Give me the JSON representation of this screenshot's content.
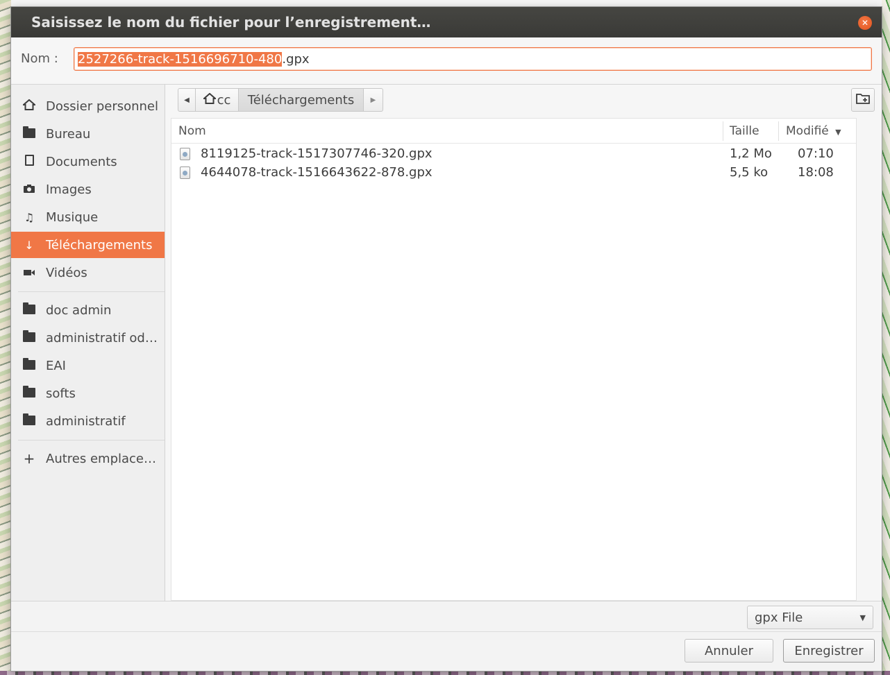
{
  "dialog": {
    "title": "Saisissez le nom du fichier pour l’enregistrement…",
    "close_icon": "close-icon"
  },
  "name_field": {
    "label": "Nom :",
    "selected_text": "2527266-track-1516696710-480",
    "unselected_text": ".gpx"
  },
  "sidebar": {
    "items": [
      {
        "label": "Dossier personnel",
        "icon": "home-icon"
      },
      {
        "label": "Bureau",
        "icon": "folder-icon"
      },
      {
        "label": "Documents",
        "icon": "document-icon"
      },
      {
        "label": "Images",
        "icon": "camera-icon"
      },
      {
        "label": "Musique",
        "icon": "music-icon"
      },
      {
        "label": "Téléchargements",
        "icon": "download-icon",
        "active": true
      },
      {
        "label": "Vidéos",
        "icon": "video-icon"
      },
      {
        "label": "doc admin",
        "icon": "folder-icon"
      },
      {
        "label": "administratif od…",
        "icon": "folder-icon"
      },
      {
        "label": "EAI",
        "icon": "folder-icon"
      },
      {
        "label": "softs",
        "icon": "folder-icon"
      },
      {
        "label": "administratif",
        "icon": "folder-icon"
      },
      {
        "label": "Autres emplace…",
        "icon": "plus-icon"
      }
    ]
  },
  "pathbar": {
    "home_label": "cc",
    "current_label": "Téléchargements"
  },
  "filelist": {
    "columns": {
      "name": "Nom",
      "size": "Taille",
      "modified": "Modifié"
    },
    "rows": [
      {
        "name": "8119125-track-1517307746-320.gpx",
        "size": "1,2 Mo",
        "modified": "07:10"
      },
      {
        "name": "4644078-track-1516643622-878.gpx",
        "size": "5,5 ko",
        "modified": "18:08"
      }
    ]
  },
  "filter": {
    "selected": "gpx File"
  },
  "buttons": {
    "cancel": "Annuler",
    "save": "Enregistrer"
  },
  "colors": {
    "accent": "#f07746",
    "titlebar": "#3e3e3b",
    "background": "#f6f6f6"
  }
}
